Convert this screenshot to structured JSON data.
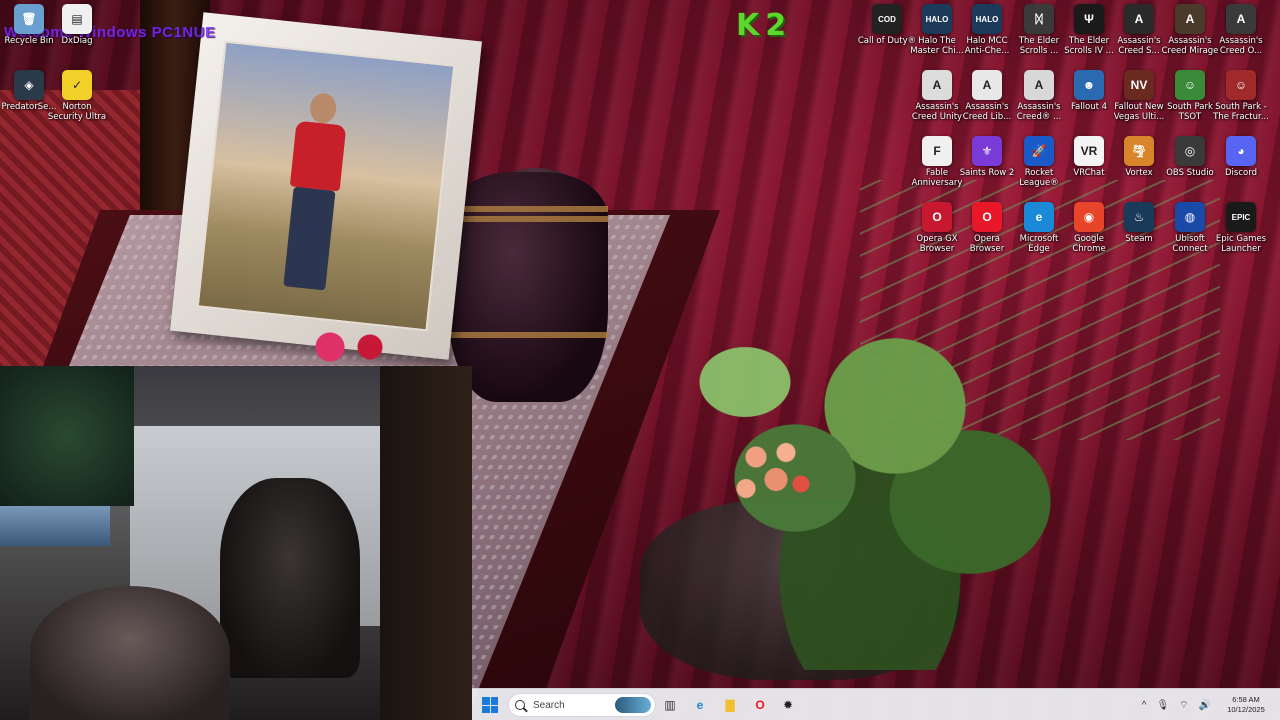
{
  "overlay": {
    "watermark_text": "Welcome Windows PC1NUE",
    "logo_text": "K2"
  },
  "desktop_icons": [
    {
      "id": "recycle-bin",
      "label": "Recycle Bin",
      "glyph": "🗑",
      "color": "#6aa0d0"
    },
    {
      "id": "dxdiag",
      "label": "DxDiag",
      "glyph": "▤",
      "color": "#f0f0f0"
    },
    {
      "id": "predatorsense",
      "label": "PredatorSe...",
      "glyph": "◈",
      "color": "#2a3a48"
    },
    {
      "id": "norton",
      "label": "Norton Security Ultra",
      "glyph": "✓",
      "color": "#f2d02a"
    },
    {
      "id": "call-of-duty",
      "label": "Call of Duty®",
      "glyph": "COD",
      "color": "#222222"
    },
    {
      "id": "halo-mcc-1",
      "label": "Halo The Master Chi...",
      "glyph": "HALO",
      "color": "#1c3a5a"
    },
    {
      "id": "halo-mcc-2",
      "label": "Halo MCC Anti-Che...",
      "glyph": "HALO",
      "color": "#1c3a5a"
    },
    {
      "id": "elder-scrolls-5",
      "label": "The Elder Scrolls ...",
      "glyph": "ᛞ",
      "color": "#3a3a3a"
    },
    {
      "id": "elder-scrolls-4",
      "label": "The Elder Scrolls IV ...",
      "glyph": "Ψ",
      "color": "#1a1a1a"
    },
    {
      "id": "ac-s",
      "label": "Assassin's Creed S...",
      "glyph": "A",
      "color": "#2a2a2a"
    },
    {
      "id": "ac-mirage",
      "label": "Assassin's Creed Mirage",
      "glyph": "A",
      "color": "#4a3a2a"
    },
    {
      "id": "ac-o",
      "label": "Assassin's Creed O...",
      "glyph": "A",
      "color": "#3a3a3a"
    },
    {
      "id": "ac-unity",
      "label": "Assassin's Creed Unity",
      "glyph": "A",
      "color": "#dcdcdc"
    },
    {
      "id": "ac-lib",
      "label": "Assassin's Creed Lib...",
      "glyph": "A",
      "color": "#e8e8e8"
    },
    {
      "id": "ac-3",
      "label": "Assassin's Creed® ...",
      "glyph": "A",
      "color": "#d8d8d8"
    },
    {
      "id": "fallout4",
      "label": "Fallout 4",
      "glyph": "☻",
      "color": "#2a6ab0"
    },
    {
      "id": "fallout-nv",
      "label": "Fallout New Vegas Ulti...",
      "glyph": "NV",
      "color": "#6a2a20"
    },
    {
      "id": "south-park-tsot",
      "label": "South Park TSOT",
      "glyph": "☺",
      "color": "#3a8a3a"
    },
    {
      "id": "south-park-fractured",
      "label": "South Park - The Fractur...",
      "glyph": "☺",
      "color": "#a02a2a"
    },
    {
      "id": "fable",
      "label": "Fable Anniversary",
      "glyph": "F",
      "color": "#f0f0f0"
    },
    {
      "id": "saints-row",
      "label": "Saints Row 2",
      "glyph": "⚜",
      "color": "#7a3ad8"
    },
    {
      "id": "rocket-league",
      "label": "Rocket League®",
      "glyph": "🚀",
      "color": "#1a5ac8"
    },
    {
      "id": "vrchat",
      "label": "VRChat",
      "glyph": "VR",
      "color": "#f4f4f4"
    },
    {
      "id": "vortex",
      "label": "Vortex",
      "glyph": "🌪",
      "color": "#d8842a"
    },
    {
      "id": "obs",
      "label": "OBS Studio",
      "glyph": "◎",
      "color": "#3a3a3a"
    },
    {
      "id": "discord",
      "label": "Discord",
      "glyph": "◕",
      "color": "#5865f2"
    },
    {
      "id": "opera-gx",
      "label": "Opera GX Browser",
      "glyph": "O",
      "color": "#c81830"
    },
    {
      "id": "opera",
      "label": "Opera Browser",
      "glyph": "O",
      "color": "#e81828"
    },
    {
      "id": "edge",
      "label": "Microsoft Edge",
      "glyph": "e",
      "color": "#1a8ad8"
    },
    {
      "id": "chrome",
      "label": "Google Chrome",
      "glyph": "◉",
      "color": "#e8442a"
    },
    {
      "id": "steam",
      "label": "Steam",
      "glyph": "♨",
      "color": "#1a3a5a"
    },
    {
      "id": "ubisoft",
      "label": "Ubisoft Connect",
      "glyph": "◍",
      "color": "#1a4aa8"
    },
    {
      "id": "epic",
      "label": "Epic Games Launcher",
      "glyph": "EPIC",
      "color": "#1a1a1a"
    }
  ],
  "taskbar": {
    "search_placeholder": "Search",
    "apps": [
      {
        "id": "task-view",
        "glyph": "▥",
        "color": "#333333"
      },
      {
        "id": "edge",
        "glyph": "e",
        "color": "#1a8ad8"
      },
      {
        "id": "file-explorer",
        "glyph": "▇",
        "color": "#f0c030"
      },
      {
        "id": "opera",
        "glyph": "O",
        "color": "#e81828"
      },
      {
        "id": "app-settings",
        "glyph": "✹",
        "color": "#222222"
      }
    ],
    "tray": {
      "chevron": "^",
      "mic": "🎙",
      "wifi": "⌔",
      "volume": "🔊",
      "time": "6:58 AM",
      "date": "10/12/2025"
    }
  }
}
